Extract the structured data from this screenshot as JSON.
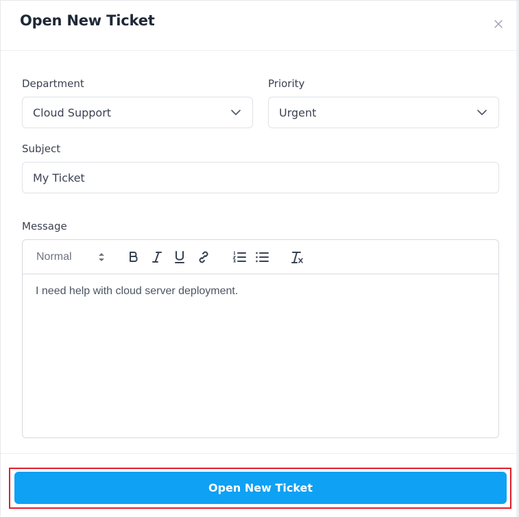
{
  "modal": {
    "title": "Open New Ticket"
  },
  "form": {
    "department": {
      "label": "Department",
      "value": "Cloud Support"
    },
    "priority": {
      "label": "Priority",
      "value": "Urgent"
    },
    "subject": {
      "label": "Subject",
      "value": "My Ticket"
    },
    "message": {
      "label": "Message",
      "format_select": "Normal",
      "toolbar_icons": [
        "bold-icon",
        "italic-icon",
        "underline-icon",
        "link-icon",
        "ordered-list-icon",
        "bullet-list-icon",
        "clear-format-icon"
      ],
      "content": "I need help with cloud server deployment."
    }
  },
  "footer": {
    "submit_label": "Open New Ticket"
  },
  "colors": {
    "primary": "#0ea1f4",
    "highlight": "#e11d2a",
    "text": "#1f2937",
    "border": "#dfe2e7"
  }
}
